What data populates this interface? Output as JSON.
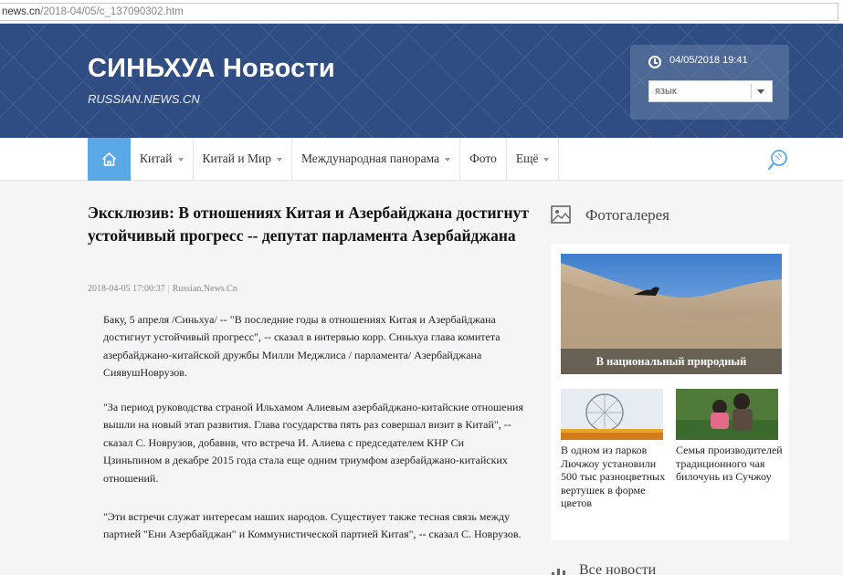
{
  "browser": {
    "url_prefix": "news.cn",
    "url_rest": "/2018-04/05/c_137090302.htm"
  },
  "header": {
    "title": "СИНЬХУА Новости",
    "subtitle": "RUSSIAN.NEWS.CN",
    "datetime": "04/05/2018 19:41",
    "language_select": "язык"
  },
  "nav": {
    "home_icon": "home-icon",
    "items": [
      {
        "label": "Китай",
        "dropdown": true
      },
      {
        "label": "Китай и Мир",
        "dropdown": true
      },
      {
        "label": "Международная панорама",
        "dropdown": true
      },
      {
        "label": "Фото",
        "dropdown": false
      },
      {
        "label": "Ещё",
        "dropdown": true
      }
    ],
    "search_icon": "search-icon"
  },
  "article": {
    "title": "Эксклюзив: В отношениях Китая и Азербайджана достигнут устойчивый прогресс -- депутат парламента Азербайджана",
    "date": "2018-04-05 17:00:37",
    "source": "Russian.News.Cn",
    "paragraphs": [
      "Баку, 5 апреля /Синьхуа/ -- \"В последние годы в отношениях Китая и Азербайджана достигнут устойчивый прогресс\", -- сказал в интервью корр. Синьхуа глава комитета азербайджано-китайской дружбы Милли Меджлиса / парламента/ Азербайджана СиявушНоврузов.",
      "\"За период руководства страной Ильхамом Алиевым азербайджано-китайские отношения вышли на новый этап развития. Глава государства пять раз совершал визит в Китай\", -- сказал С. Новрузов, добавив, что встреча И. Алиева с председателем КНР Си Цзиньпином в декабре 2015 года стала еще одним триумфом азербайджано-китайских отношений.",
      "\"Эти встречи служат интересам наших народов. Существует также тесная связь между партией \"Ени Азербайджан\" и Коммунистической партией Китая\", -- сказал С. Новрузов."
    ]
  },
  "sidebar": {
    "gallery_title": "Фотогалерея",
    "feature_caption": "В национальный природный",
    "thumbs": [
      {
        "caption": "В одном из парков Лючжоу установили 500 тыс разноцветных вертушек в форме цветов"
      },
      {
        "caption": "Семья производителей традиционного чая билочунь из Сучжоу"
      }
    ],
    "allnews_title": "Все новости"
  },
  "colors": {
    "header_bg": "#2f4d82",
    "nav_home_bg": "#5aa8e6",
    "page_bg": "#f4f5f7"
  }
}
